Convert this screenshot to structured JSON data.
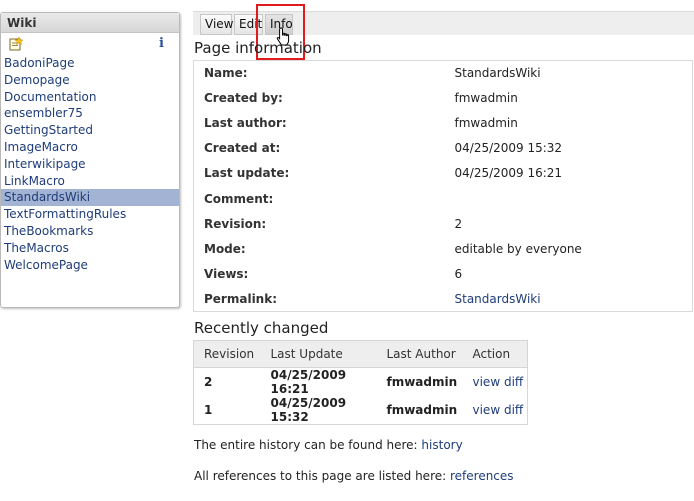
{
  "sidebar": {
    "title": "Wiki",
    "info_glyph": "i",
    "pages": [
      "BadoniPage",
      "Demopage",
      "Documentation",
      "ensembler75",
      "GettingStarted",
      "ImageMacro",
      "Interwikipage",
      "LinkMacro",
      "StandardsWiki",
      "TextFormattingRules",
      "TheBookmarks",
      "TheMacros",
      "WelcomePage"
    ],
    "selected": "StandardsWiki"
  },
  "tabs": {
    "view": "View",
    "edit": "Edit",
    "info": "Info"
  },
  "page_info": {
    "title": "Page information",
    "rows": [
      {
        "label": "Name:",
        "value": "StandardsWiki"
      },
      {
        "label": "Created by:",
        "value": "fmwadmin"
      },
      {
        "label": "Last author:",
        "value": "fmwadmin"
      },
      {
        "label": "Created at:",
        "value": "04/25/2009 15:32"
      },
      {
        "label": "Last update:",
        "value": "04/25/2009 16:21"
      },
      {
        "label": "Comment:",
        "value": ""
      },
      {
        "label": "Revision:",
        "value": "2"
      },
      {
        "label": "Mode:",
        "value": "editable by everyone"
      },
      {
        "label": "Views:",
        "value": "6"
      },
      {
        "label": "Permalink:",
        "value": "StandardsWiki"
      }
    ]
  },
  "recent": {
    "title": "Recently changed",
    "headers": [
      "Revision",
      "Last Update",
      "Last Author",
      "Action"
    ],
    "rows": [
      {
        "revision": "2",
        "last_update": "04/25/2009 16:21",
        "last_author": "fmwadmin",
        "action": "view diff"
      },
      {
        "revision": "1",
        "last_update": "04/25/2009 15:32",
        "last_author": "fmwadmin",
        "action": "view diff"
      }
    ]
  },
  "footer": {
    "history_text": "The entire history can be found here: ",
    "history_link": "history",
    "references_text": "All references to this page are listed here: ",
    "references_link": "references"
  }
}
